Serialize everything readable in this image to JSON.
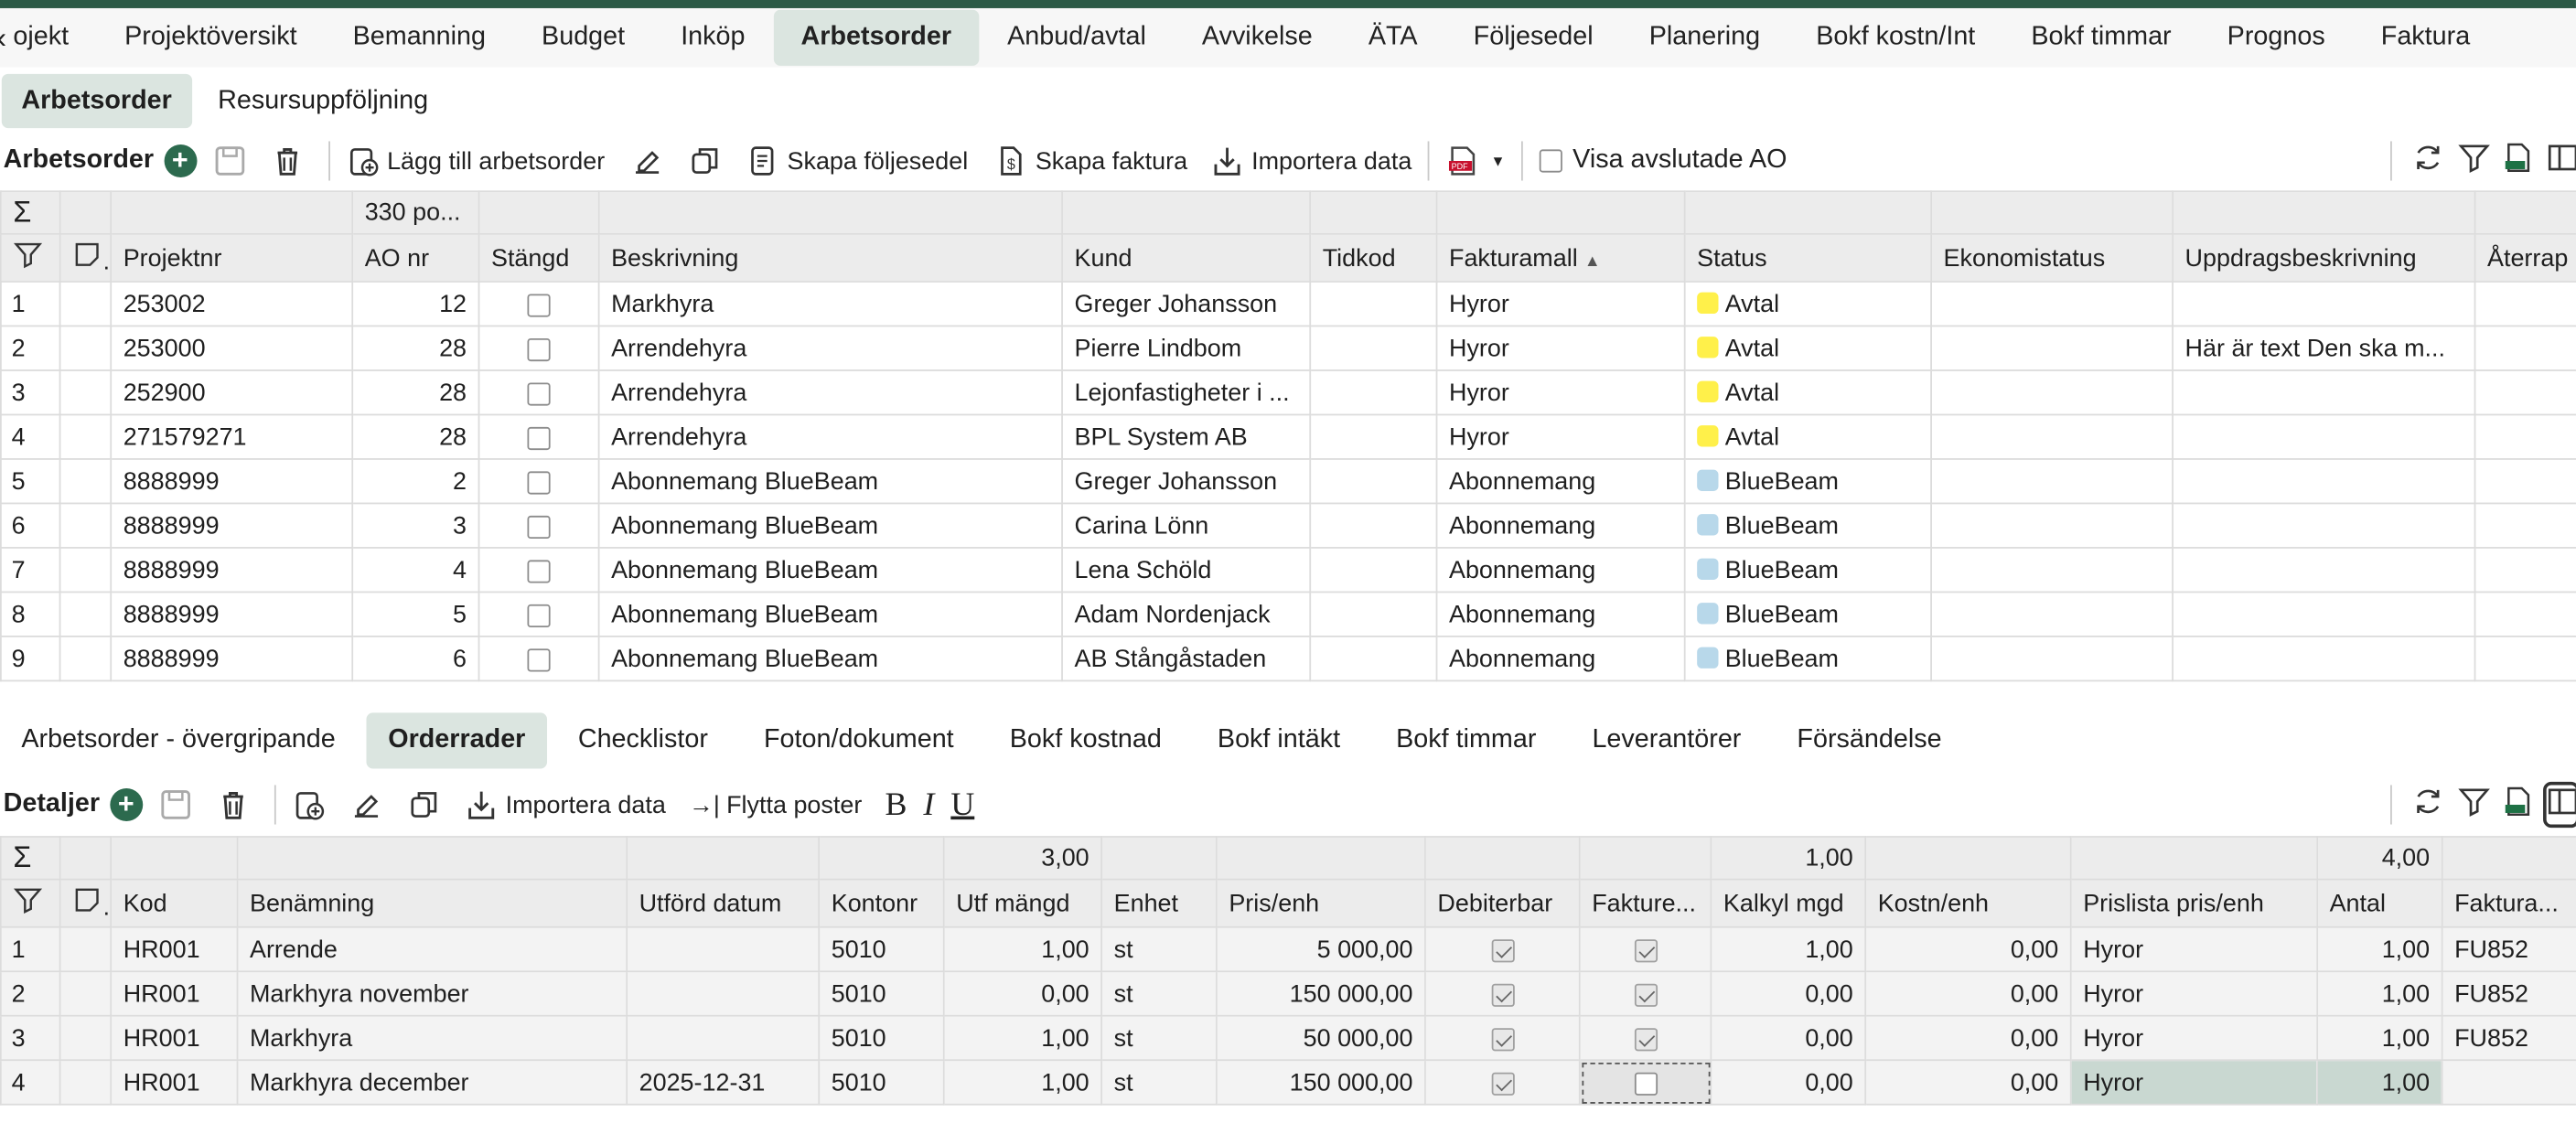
{
  "nav": [
    "ojekt",
    "Projektöversikt",
    "Bemanning",
    "Budget",
    "Inköp",
    "Arbetsorder",
    "Anbud/avtal",
    "Avvikelse",
    "ÄTA",
    "Följesedel",
    "Planering",
    "Bokf kostn/Int",
    "Bokf timmar",
    "Prognos",
    "Faktura"
  ],
  "subnav": [
    "Arbetsorder",
    "Resursuppföljning"
  ],
  "toolbar1": {
    "title": "Arbetsorder",
    "add": "Lägg till arbetsorder",
    "folj": "Skapa följesedel",
    "faktura": "Skapa faktura",
    "import": "Importera data",
    "visa": "Visa avslutade AO"
  },
  "grid1": {
    "sum_ao": "330 po...",
    "headers": [
      "Projektnr",
      "AO nr",
      "Stängd",
      "Beskrivning",
      "Kund",
      "Tidkod",
      "Fakturamall",
      "Status",
      "Ekonomistatus",
      "Uppdragsbeskrivning",
      "Återrap"
    ],
    "rows": [
      [
        "1",
        "253002",
        "12",
        "Markhyra",
        "Greger Johansson",
        "",
        "Hyror",
        "Avtal",
        "",
        "",
        ""
      ],
      [
        "2",
        "253000",
        "28",
        "Arrendehyra",
        "Pierre Lindbom",
        "",
        "Hyror",
        "Avtal",
        "",
        "Här är text   Den ska m...",
        ""
      ],
      [
        "3",
        "252900",
        "28",
        "Arrendehyra",
        "Lejonfastigheter i ...",
        "",
        "Hyror",
        "Avtal",
        "",
        "",
        ""
      ],
      [
        "4",
        "271579271",
        "28",
        "Arrendehyra",
        "BPL System AB",
        "",
        "Hyror",
        "Avtal",
        "",
        "",
        ""
      ],
      [
        "5",
        "8888999",
        "2",
        "Abonnemang BlueBeam",
        "Greger Johansson",
        "",
        "Abonnemang",
        "BlueBeam",
        "",
        "",
        ""
      ],
      [
        "6",
        "8888999",
        "3",
        "Abonnemang BlueBeam",
        "Carina Lönn",
        "",
        "Abonnemang",
        "BlueBeam",
        "",
        "",
        ""
      ],
      [
        "7",
        "8888999",
        "4",
        "Abonnemang BlueBeam",
        "Lena Schöld",
        "",
        "Abonnemang",
        "BlueBeam",
        "",
        "",
        ""
      ],
      [
        "8",
        "8888999",
        "5",
        "Abonnemang BlueBeam",
        "Adam Nordenjack",
        "",
        "Abonnemang",
        "BlueBeam",
        "",
        "",
        ""
      ],
      [
        "9",
        "8888999",
        "6",
        "Abonnemang BlueBeam",
        "AB Stångåstaden",
        "",
        "Abonnemang",
        "BlueBeam",
        "",
        "",
        ""
      ]
    ],
    "status_colors": {
      "Avtal": "#fff04a",
      "BlueBeam": "#b8d8ea"
    }
  },
  "tabs2": [
    "Arbetsorder - övergripande",
    "Orderrader",
    "Checklistor",
    "Foton/dokument",
    "Bokf kostnad",
    "Bokf intäkt",
    "Bokf timmar",
    "Leverantörer",
    "Försändelse"
  ],
  "toolbar2": {
    "title": "Detaljer",
    "import": "Importera data",
    "flytta": "Flytta poster"
  },
  "grid2": {
    "sums": {
      "utf": "3,00",
      "kalkyl": "1,00",
      "antal": "4,00"
    },
    "headers": [
      "Kod",
      "Benämning",
      "Utförd datum",
      "Kontonr",
      "Utf mängd",
      "Enhet",
      "Pris/enh",
      "Debiterbar",
      "Fakture...",
      "Kalkyl mgd",
      "Kostn/enh",
      "Prislista pris/enh",
      "Antal",
      "Faktura..."
    ],
    "rows": [
      [
        "1",
        "HR001",
        "Arrende",
        "",
        "5010",
        "1,00",
        "st",
        "5 000,00",
        "1",
        "1",
        "1,00",
        "0,00",
        "Hyror",
        "1,00",
        "FU852"
      ],
      [
        "2",
        "HR001",
        "Markhyra november",
        "",
        "5010",
        "0,00",
        "st",
        "150 000,00",
        "1",
        "1",
        "0,00",
        "0,00",
        "Hyror",
        "1,00",
        "FU852"
      ],
      [
        "3",
        "HR001",
        "Markhyra",
        "",
        "5010",
        "1,00",
        "st",
        "50 000,00",
        "1",
        "1",
        "0,00",
        "0,00",
        "Hyror",
        "1,00",
        "FU852"
      ],
      [
        "4",
        "HR001",
        "Markhyra december",
        "2025-12-31",
        "5010",
        "1,00",
        "st",
        "150 000,00",
        "1",
        "0",
        "0,00",
        "0,00",
        "Hyror",
        "1,00",
        ""
      ]
    ]
  }
}
